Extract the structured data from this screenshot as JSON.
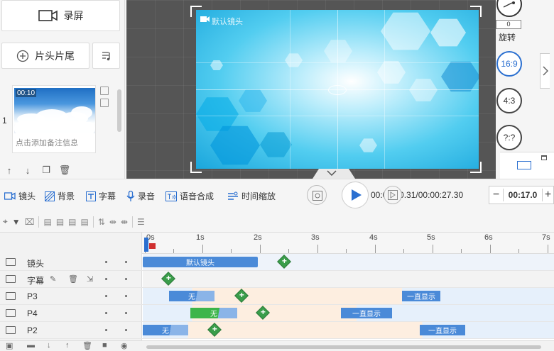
{
  "left_panel": {
    "record_label": "录屏",
    "head_tail_label": "片头片尾",
    "clip_number": "1",
    "clip_time": "00:10",
    "clip_note": "点击添加备注信息"
  },
  "canvas": {
    "label": "默认镜头"
  },
  "right_panel": {
    "rotate_value": "0",
    "rotate_label": "旋转",
    "ratio_16_9": "16:9",
    "ratio_4_3": "4:3",
    "ratio_custom": "?:?"
  },
  "toolbar": {
    "camera": "镜头",
    "background": "背景",
    "subtitle": "字幕",
    "record_audio": "录音",
    "tts": "语音合成",
    "time_scale": "时间缩放"
  },
  "playback": {
    "time_display": "00:00:00.31/00:00:27.30",
    "zoom_value": "00:17.0"
  },
  "ruler": {
    "ticks": [
      "0s",
      "1s",
      "2s",
      "3s",
      "4s",
      "5s",
      "6s",
      "7s"
    ]
  },
  "tracks": [
    {
      "name": "镜头",
      "clips": [
        {
          "label": "默认镜头"
        }
      ]
    },
    {
      "name": "字幕",
      "clips": []
    },
    {
      "name": "P3",
      "clips": [
        {
          "label": "无"
        },
        {
          "label": "一直显示"
        }
      ]
    },
    {
      "name": "P4",
      "clips": [
        {
          "label": "无"
        },
        {
          "label": "一直显示"
        }
      ]
    },
    {
      "name": "P2",
      "clips": [
        {
          "label": "无"
        },
        {
          "label": "一直显示"
        }
      ]
    }
  ],
  "colors": {
    "accent": "#2a6fd0",
    "clip_blue": "#4a8ad8",
    "clip_green": "#3cb54a",
    "lane_orange": "#fdeee0",
    "lane_blue": "#e6f0fb"
  }
}
